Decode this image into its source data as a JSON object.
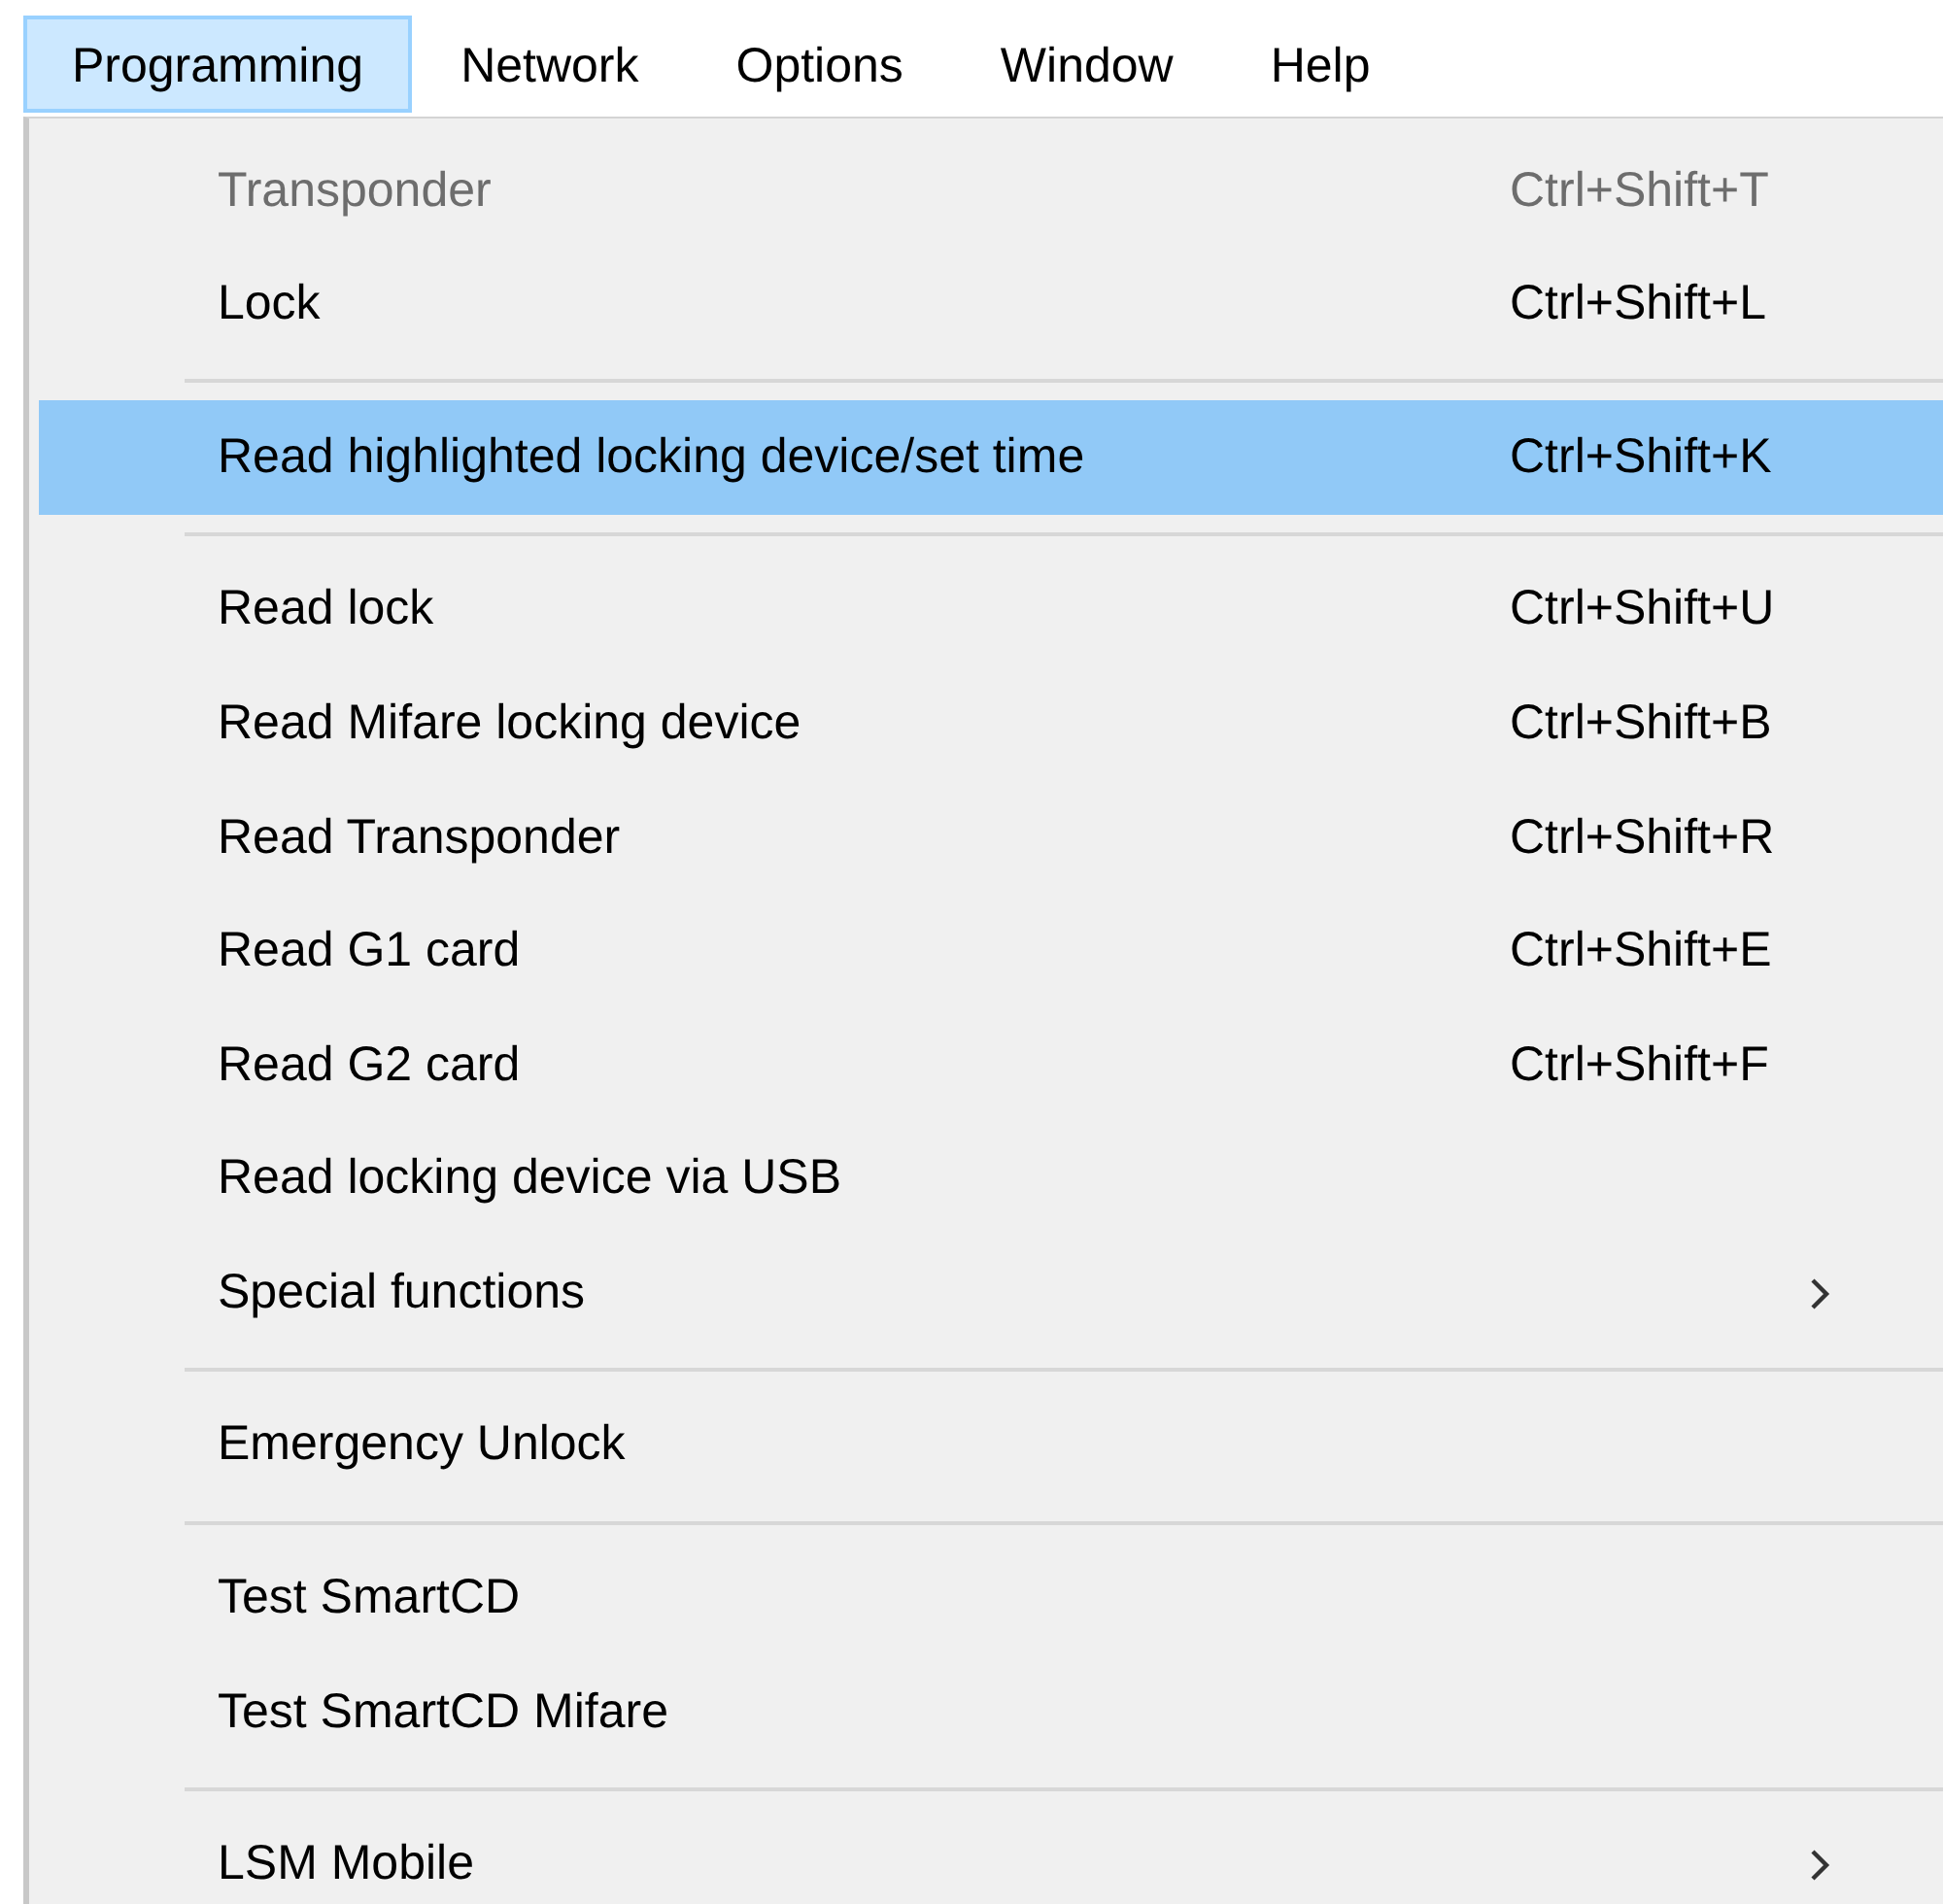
{
  "menubar": [
    {
      "label": "Programming",
      "selected": true
    },
    {
      "label": "Network",
      "selected": false
    },
    {
      "label": "Options",
      "selected": false
    },
    {
      "label": "Window",
      "selected": false
    },
    {
      "label": "Help",
      "selected": false
    }
  ],
  "menu": [
    {
      "kind": "item",
      "label": "Transponder",
      "shortcut": "Ctrl+Shift+T",
      "disabled": true,
      "selected": false
    },
    {
      "kind": "item",
      "label": "Lock",
      "shortcut": "Ctrl+Shift+L",
      "disabled": false,
      "selected": false
    },
    {
      "kind": "separator"
    },
    {
      "kind": "item",
      "label": "Read highlighted locking device/set time",
      "shortcut": "Ctrl+Shift+K",
      "disabled": false,
      "selected": true
    },
    {
      "kind": "separator"
    },
    {
      "kind": "item",
      "label": "Read lock",
      "shortcut": "Ctrl+Shift+U",
      "disabled": false,
      "selected": false
    },
    {
      "kind": "item",
      "label": "Read Mifare locking device",
      "shortcut": "Ctrl+Shift+B",
      "disabled": false,
      "selected": false
    },
    {
      "kind": "item",
      "label": "Read Transponder",
      "shortcut": "Ctrl+Shift+R",
      "disabled": false,
      "selected": false
    },
    {
      "kind": "item",
      "label": "Read G1 card",
      "shortcut": "Ctrl+Shift+E",
      "disabled": false,
      "selected": false
    },
    {
      "kind": "item",
      "label": "Read G2 card",
      "shortcut": "Ctrl+Shift+F",
      "disabled": false,
      "selected": false
    },
    {
      "kind": "item",
      "label": "Read locking device via USB",
      "disabled": false,
      "selected": false
    },
    {
      "kind": "submenu",
      "label": "Special functions",
      "disabled": false,
      "selected": false
    },
    {
      "kind": "separator"
    },
    {
      "kind": "item",
      "label": "Emergency Unlock",
      "disabled": false,
      "selected": false
    },
    {
      "kind": "separator"
    },
    {
      "kind": "item",
      "label": "Test SmartCD",
      "disabled": false,
      "selected": false
    },
    {
      "kind": "item",
      "label": "Test SmartCD Mifare",
      "disabled": false,
      "selected": false
    },
    {
      "kind": "separator"
    },
    {
      "kind": "submenu",
      "label": "LSM Mobile",
      "disabled": false,
      "selected": false
    }
  ]
}
